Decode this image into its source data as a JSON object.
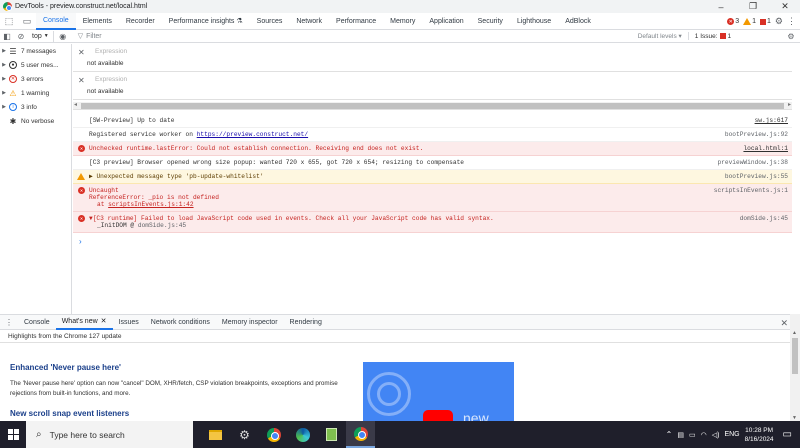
{
  "window": {
    "title": "DevTools - preview.construct.net/local.html",
    "controls": {
      "minimize": "–",
      "restore": "❐",
      "close": "✕"
    }
  },
  "tabs": [
    "Console",
    "Elements",
    "Recorder",
    "Performance insights ⚗",
    "Sources",
    "Network",
    "Performance",
    "Memory",
    "Application",
    "Security",
    "Lighthouse",
    "AdBlock"
  ],
  "active_tab": "Console",
  "counters": {
    "errors": "3",
    "warnings": "1",
    "issues": "1"
  },
  "toolbar": {
    "context": "top",
    "filter_placeholder": "Filter",
    "levels": "Default levels ▾",
    "issues_label": "1 Issue:",
    "issues_count": "1"
  },
  "sidebar": {
    "items": [
      {
        "label": "7 messages",
        "icon": "list-icon"
      },
      {
        "label": "5 user mes...",
        "icon": "user-icon"
      },
      {
        "label": "3 errors",
        "icon": "error-icon"
      },
      {
        "label": "1 warning",
        "icon": "warning-icon"
      },
      {
        "label": "3 info",
        "icon": "info-icon"
      },
      {
        "label": "No verbose",
        "icon": "bug-icon"
      }
    ]
  },
  "live_expressions": [
    {
      "placeholder": "Expression",
      "value": "not available"
    },
    {
      "placeholder": "Expression",
      "value": "not available"
    }
  ],
  "messages": [
    {
      "level": "info",
      "text": "[SW-Preview] Up to date",
      "source": "sw.js:617",
      "source_link": true
    },
    {
      "level": "info",
      "text": "Registered service worker on ",
      "link": "https://preview.construct.net/",
      "source": "bootPreview.js:92",
      "source_link": false
    },
    {
      "level": "error",
      "text": "Unchecked runtime.lastError: Could not establish connection. Receiving end does not exist.",
      "source": "local.html:1",
      "source_link": true
    },
    {
      "level": "info",
      "text": "[C3 preview] Browser opened wrong size popup: wanted 720 x 655, got 720 x 654; resizing to compensate",
      "source": "previewWindow.js:38",
      "source_link": false
    },
    {
      "level": "warn",
      "text": "▶ Unexpected message type 'pb-update-whitelist'",
      "source": "bootPreview.js:55",
      "source_link": false
    },
    {
      "level": "error",
      "text": "Uncaught",
      "line2": "ReferenceError: _pio is not defined",
      "stack_prefix": "at ",
      "stack_link": "scriptsInEvents.js:1:42",
      "source": "scriptsInEvents.js:1",
      "source_link": false
    },
    {
      "level": "error",
      "text": "▼[C3 runtime] Failed to load JavaScript code used in events. Check all your JavaScript code has valid syntax.",
      "line2_prefix": "_InitDOM @ ",
      "line2_src": "domSide.js:45",
      "source": "domSide.js:45",
      "source_link": false
    }
  ],
  "prompt": "›",
  "drawer": {
    "tabs": [
      "Console",
      "What's new",
      "Issues",
      "Network conditions",
      "Memory inspector",
      "Rendering"
    ],
    "active_tab": "What's new",
    "highlights": "Highlights from the Chrome 127 update",
    "heading1": "Enhanced 'Never pause here'",
    "paragraph1": "The 'Never pause here' option can now \"cancel\" DOM, XHR/fetch, CSP violation breakpoints, exceptions and promise rejections from built-in functions, and more.",
    "heading2": "New scroll snap event listeners",
    "video_text": "new"
  },
  "taskbar": {
    "search_placeholder": "Type here to search",
    "apps": [
      "file-explorer-icon",
      "settings-icon",
      "chrome-icon",
      "edge-icon",
      "notepad-icon",
      "chrome-icon"
    ],
    "tray": {
      "lang": "ENG",
      "time": "10:28 PM",
      "date": "8/16/2024"
    }
  },
  "colors": {
    "accent": "#1a73e8",
    "error": "#d93025",
    "warning": "#f29900",
    "taskbar": "#1f1f2b"
  }
}
